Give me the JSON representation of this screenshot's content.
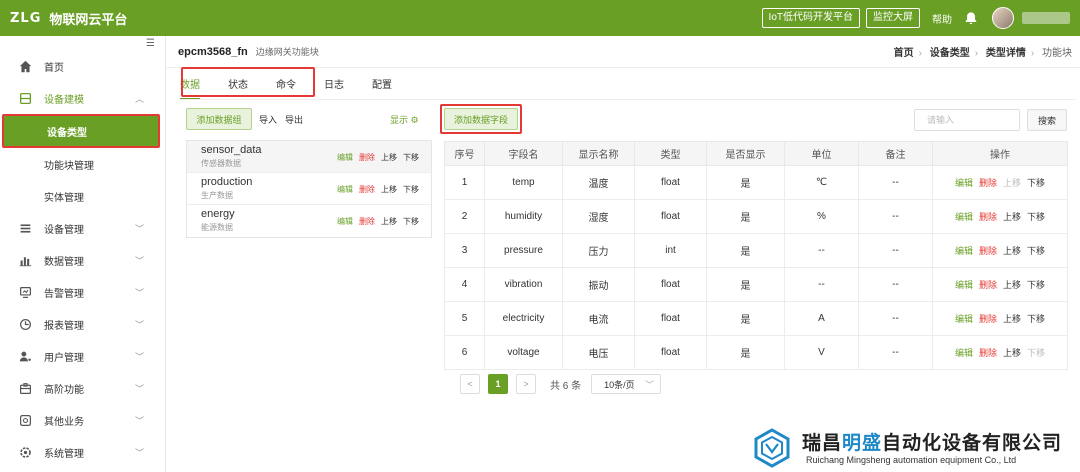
{
  "topbar": {
    "logo": "ZLG",
    "title": "物联网云平台",
    "btn_lowcode": "IoT低代码开发平台",
    "btn_screen": "监控大屏",
    "help": "帮助"
  },
  "sidebar": {
    "items": [
      {
        "label": "首页",
        "icon": "home-icon"
      },
      {
        "label": "设备建模",
        "icon": "cube-icon"
      },
      {
        "label": "设备类型"
      },
      {
        "label": "功能块管理"
      },
      {
        "label": "实体管理"
      },
      {
        "label": "设备管理",
        "icon": "device-icon"
      },
      {
        "label": "数据管理",
        "icon": "chart-icon"
      },
      {
        "label": "告警管理",
        "icon": "alarm-icon"
      },
      {
        "label": "报表管理",
        "icon": "report-icon"
      },
      {
        "label": "用户管理",
        "icon": "user-icon"
      },
      {
        "label": "高阶功能",
        "icon": "advanced-icon"
      },
      {
        "label": "其他业务",
        "icon": "other-icon"
      },
      {
        "label": "系统管理",
        "icon": "settings-icon"
      }
    ]
  },
  "header": {
    "title": "epcm3568_fn",
    "subtitle": "边缘网关功能块",
    "breadcrumb": [
      "首页",
      "设备类型",
      "类型详情",
      "功能块"
    ]
  },
  "tabs": [
    "数据",
    "状态",
    "命令",
    "日志",
    "配置"
  ],
  "groups_panel": {
    "add_btn": "添加数据组",
    "import": "导入",
    "export": "导出",
    "display": "显示",
    "groups": [
      {
        "name": "sensor_data",
        "desc": "传感器数据"
      },
      {
        "name": "production",
        "desc": "生产数据"
      },
      {
        "name": "energy",
        "desc": "能源数据"
      }
    ],
    "ops": {
      "edit": "编辑",
      "delete": "删除",
      "up": "上移",
      "down": "下移"
    }
  },
  "fields_panel": {
    "add_btn": "添加数据字段",
    "search_placeholder": "请输入",
    "search_btn": "搜索",
    "columns": [
      "序号",
      "字段名",
      "显示名称",
      "类型",
      "是否显示",
      "单位",
      "备注",
      "操作"
    ],
    "rows": [
      {
        "no": "1",
        "name": "temp",
        "display": "温度",
        "type": "float",
        "show": "是",
        "unit": "℃",
        "note": "--"
      },
      {
        "no": "2",
        "name": "humidity",
        "display": "湿度",
        "type": "float",
        "show": "是",
        "unit": "%",
        "note": "--"
      },
      {
        "no": "3",
        "name": "pressure",
        "display": "压力",
        "type": "int",
        "show": "是",
        "unit": "--",
        "note": "--"
      },
      {
        "no": "4",
        "name": "vibration",
        "display": "振动",
        "type": "float",
        "show": "是",
        "unit": "--",
        "note": "--"
      },
      {
        "no": "5",
        "name": "electricity",
        "display": "电流",
        "type": "float",
        "show": "是",
        "unit": "A",
        "note": "--"
      },
      {
        "no": "6",
        "name": "voltage",
        "display": "电压",
        "type": "float",
        "show": "是",
        "unit": "V",
        "note": "--"
      }
    ],
    "ops": {
      "edit": "编辑",
      "delete": "删除",
      "up": "上移",
      "down": "下移"
    },
    "pager": {
      "prev": "<",
      "current": "1",
      "next": ">",
      "total": "共 6 条",
      "size": "10条/页"
    }
  },
  "watermark": {
    "cn_a": "瑞昌",
    "cn_b": "明盛",
    "cn_c": "自动化设备有限公司",
    "en": "Ruichang Mingsheng automation equipment Co., Ltd"
  },
  "colors": {
    "brand": "#6a9f26",
    "danger": "#e53935",
    "highlight_box": "#e53935"
  }
}
